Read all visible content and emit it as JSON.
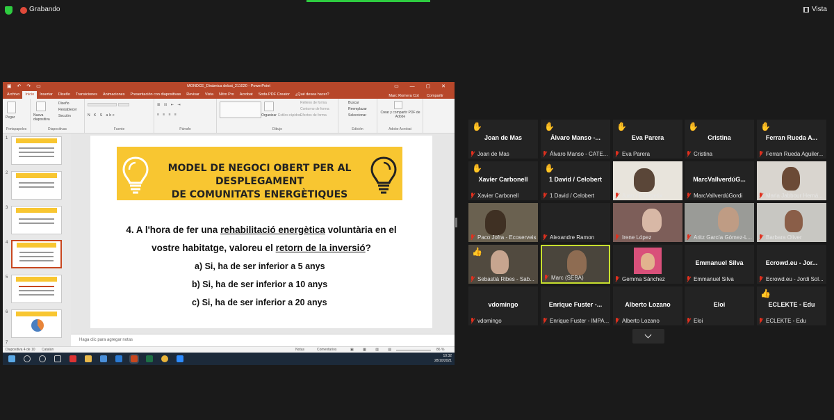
{
  "zoom": {
    "recording_label": "Grabando",
    "view_label": "Vista"
  },
  "powerpoint": {
    "window_title": "MONDCE_Dinàmica debat_211020 - PowerPoint",
    "tabs": [
      "Archivo",
      "Inicio",
      "Insertar",
      "Diseño",
      "Transiciones",
      "Animaciones",
      "Presentación con diapositivas",
      "Revisar",
      "Vista",
      "Nitro Pro",
      "Acrobat",
      "Soda PDF Creator",
      "¿Qué desea hacer?"
    ],
    "active_tab": "Inicio",
    "user": "Marc Romera Cot",
    "share": "Compartir",
    "ribbon": {
      "paste": "Pegar",
      "new_slide": "Nueva diapositiva",
      "layout": "Diseño",
      "reset": "Restablecer",
      "section": "Sección",
      "organize": "Organizar",
      "quick_styles": "Estilos rápidos",
      "shape_fill": "Relleno de forma",
      "shape_outline": "Contorno de forma",
      "shape_effects": "Efectos de forma",
      "find": "Buscar",
      "replace": "Reemplazar",
      "select": "Seleccionar",
      "create_pdf": "Crear y compartir PDF de Adobe",
      "groups": [
        "Portapapeles",
        "Diapositivas",
        "Fuente",
        "Párrafo",
        "Dibujo",
        "Edición",
        "Adobe Acrobat"
      ]
    },
    "thumbnail_numbers": [
      "1",
      "2",
      "3",
      "4",
      "5",
      "6",
      "7"
    ],
    "selected_slide": 4,
    "slide": {
      "banner_line1": "MODEL DE NEGOCI OBERT PER AL DESPLEGAMENT",
      "banner_line2": "DE COMUNITATS ENERGÈTIQUES",
      "q_part1": "4. A l'hora de fer una ",
      "q_under1": "rehabilitació energètica",
      "q_part2": " voluntària en el",
      "q_part3": "vostre habitatge, valoreu el ",
      "q_under2": "retorn de la inversió",
      "q_part4": "?",
      "options": [
        "a)   Si, ha de ser inferior  a 5 anys",
        "b)   Si, ha de ser inferior a 10 anys",
        "c)   Si, ha de ser inferior a 20 anys"
      ]
    },
    "notes_placeholder": "Haga clic para agregar notas",
    "status": {
      "slide_of": "Diapositiva 4 de 10",
      "language": "Catalán",
      "notes": "Notas",
      "comments": "Comentarios",
      "zoom": "86 %"
    },
    "clock_time": "10:32",
    "clock_date": "28/10/2021"
  },
  "participants": [
    {
      "name": "Joan de Mas",
      "foot": "Joan de Mas",
      "hand": true
    },
    {
      "name": "Álvaro Manso -...",
      "foot": "Álvaro Manso - CATE...",
      "hand": true
    },
    {
      "name": "Eva Parera",
      "foot": "Eva Parera",
      "hand": true
    },
    {
      "name": "Cristina",
      "foot": "Cristina",
      "hand": true
    },
    {
      "name": "Ferran Rueda A...",
      "foot": "Ferran Rueda Aguiler...",
      "hand": true
    },
    {
      "name": "Xavier Carbonell",
      "foot": "Xavier Carbonell",
      "hand": true
    },
    {
      "name": "1 David / Celobert",
      "foot": "1 David / Celobert",
      "hand": true
    },
    {
      "name": "",
      "foot": "Juan / Energetix",
      "video": true
    },
    {
      "name": "MarcVallverdúG...",
      "foot": "MarcVallverdúGordi"
    },
    {
      "name": "",
      "foot": "Maria Jabbour Herná...",
      "video": true
    },
    {
      "name": "",
      "foot": "Paco Jofra - Ecoserveis",
      "video": true
    },
    {
      "name": "",
      "foot": "Alexandre Ramon"
    },
    {
      "name": "",
      "foot": "Irene López",
      "video": true
    },
    {
      "name": "",
      "foot": "Aritz García Gómez-L...",
      "video": true
    },
    {
      "name": "",
      "foot": "Barbara Oliver",
      "video": true
    },
    {
      "name": "",
      "foot": "Sebastià Ribes - Sab...",
      "video": true,
      "thumb": true
    },
    {
      "name": "",
      "foot": "Marc (SEBA)",
      "video": true,
      "speaking": true
    },
    {
      "name": "",
      "foot": "Gemma Sánchez",
      "avatar": true
    },
    {
      "name": "Emmanuel Silva",
      "foot": "Emmanuel Silva"
    },
    {
      "name": "Ecrowd.eu - Jor...",
      "foot": "Ecrowd.eu - Jordi Sol..."
    },
    {
      "name": "vdomingo",
      "foot": "vdomingo"
    },
    {
      "name": "Enrique Fuster -...",
      "foot": "Enrique Fuster - IMPA..."
    },
    {
      "name": "Alberto Lozano",
      "foot": "Alberto Lozano"
    },
    {
      "name": "Eloi",
      "foot": "Eloi"
    },
    {
      "name": "ECLEKTE - Edu",
      "foot": "ECLEKTE - Edu",
      "thumb": true
    }
  ],
  "colors": {
    "ppt_red": "#b7472a",
    "banner_yellow": "#f8c631",
    "speaker_border": "#c8e02e",
    "muted_red": "#e0301e",
    "hand_yellow": "#f2b91c"
  }
}
